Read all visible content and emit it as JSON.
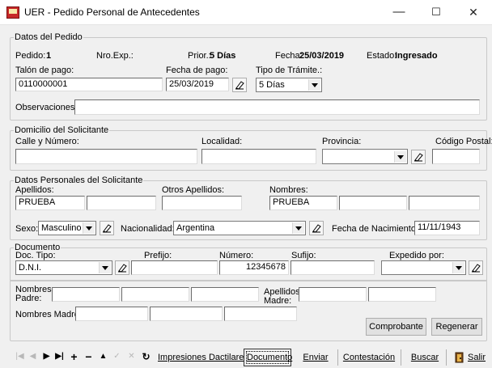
{
  "window": {
    "title": "UER - Pedido Personal de Antecedentes",
    "minimize": "—",
    "maximize": "☐",
    "close": "✕"
  },
  "datos_pedido": {
    "legend": "Datos del Pedido",
    "pedido_label": "Pedido:",
    "pedido_value": "1",
    "nro_exp_label": "Nro.Exp.:",
    "prior_label": "Prior.:",
    "prior_value": "5 Días",
    "fecha_label": "Fecha:",
    "fecha_value": "25/03/2019",
    "estado_label": "Estado:",
    "estado_value": "Ingresado",
    "talon_label": "Talón de pago:",
    "talon_value": "0110000001",
    "fecha_pago_label": "Fecha de pago:",
    "fecha_pago_value": "25/03/2019",
    "tipo_tramite_label": "Tipo de Trámite.:",
    "tipo_tramite_value": "5 Días",
    "observaciones_label": "Observaciones:",
    "observaciones_value": ""
  },
  "domicilio": {
    "legend": "Domicilio del Solicitante",
    "calle_label": "Calle y Número:",
    "localidad_label": "Localidad:",
    "provincia_label": "Provincia:",
    "codigo_postal_label": "Código Postal:",
    "calle_value": "",
    "localidad_value": "",
    "provincia_value": "",
    "codigo_postal_value": ""
  },
  "personales": {
    "legend": "Datos Personales del Solicitante",
    "apellidos_label": "Apellidos:",
    "apellido1_value": "PRUEBA",
    "otros_apellidos_label": "Otros Apellidos:",
    "nombres_label": "Nombres:",
    "nombre1_value": "PRUEBA",
    "sexo_label": "Sexo:",
    "sexo_value": "Masculino",
    "nacionalidad_label": "Nacionalidad:",
    "nacionalidad_value": "Argentina",
    "fecha_nac_label": "Fecha de Nacimiento:",
    "fecha_nac_value": "11/11/1943"
  },
  "documento": {
    "legend": "Documento",
    "doc_tipo_label": "Doc. Tipo:",
    "doc_tipo_value": "D.N.I.",
    "prefijo_label": "Prefijo:",
    "numero_label": "Número:",
    "numero_value": "12345678",
    "sufijo_label": "Sufijo:",
    "expedido_label": "Expedido por:"
  },
  "padres": {
    "nombres_padre_label": "Nombres Padre:",
    "apellidos_madre_label": "Apellidos Madre:",
    "nombres_madre_label": "Nombres Madre:",
    "comprobante_label": "Comprobante",
    "regenerar_label": "Regenerar"
  },
  "toolbar": {
    "impresiones_label": "Impresiones Dactilares",
    "documento_label": "Documento",
    "enviar_label": "Enviar",
    "contestacion_label": "Contestación",
    "buscar_label": "Buscar",
    "salir_label": "Salir"
  }
}
